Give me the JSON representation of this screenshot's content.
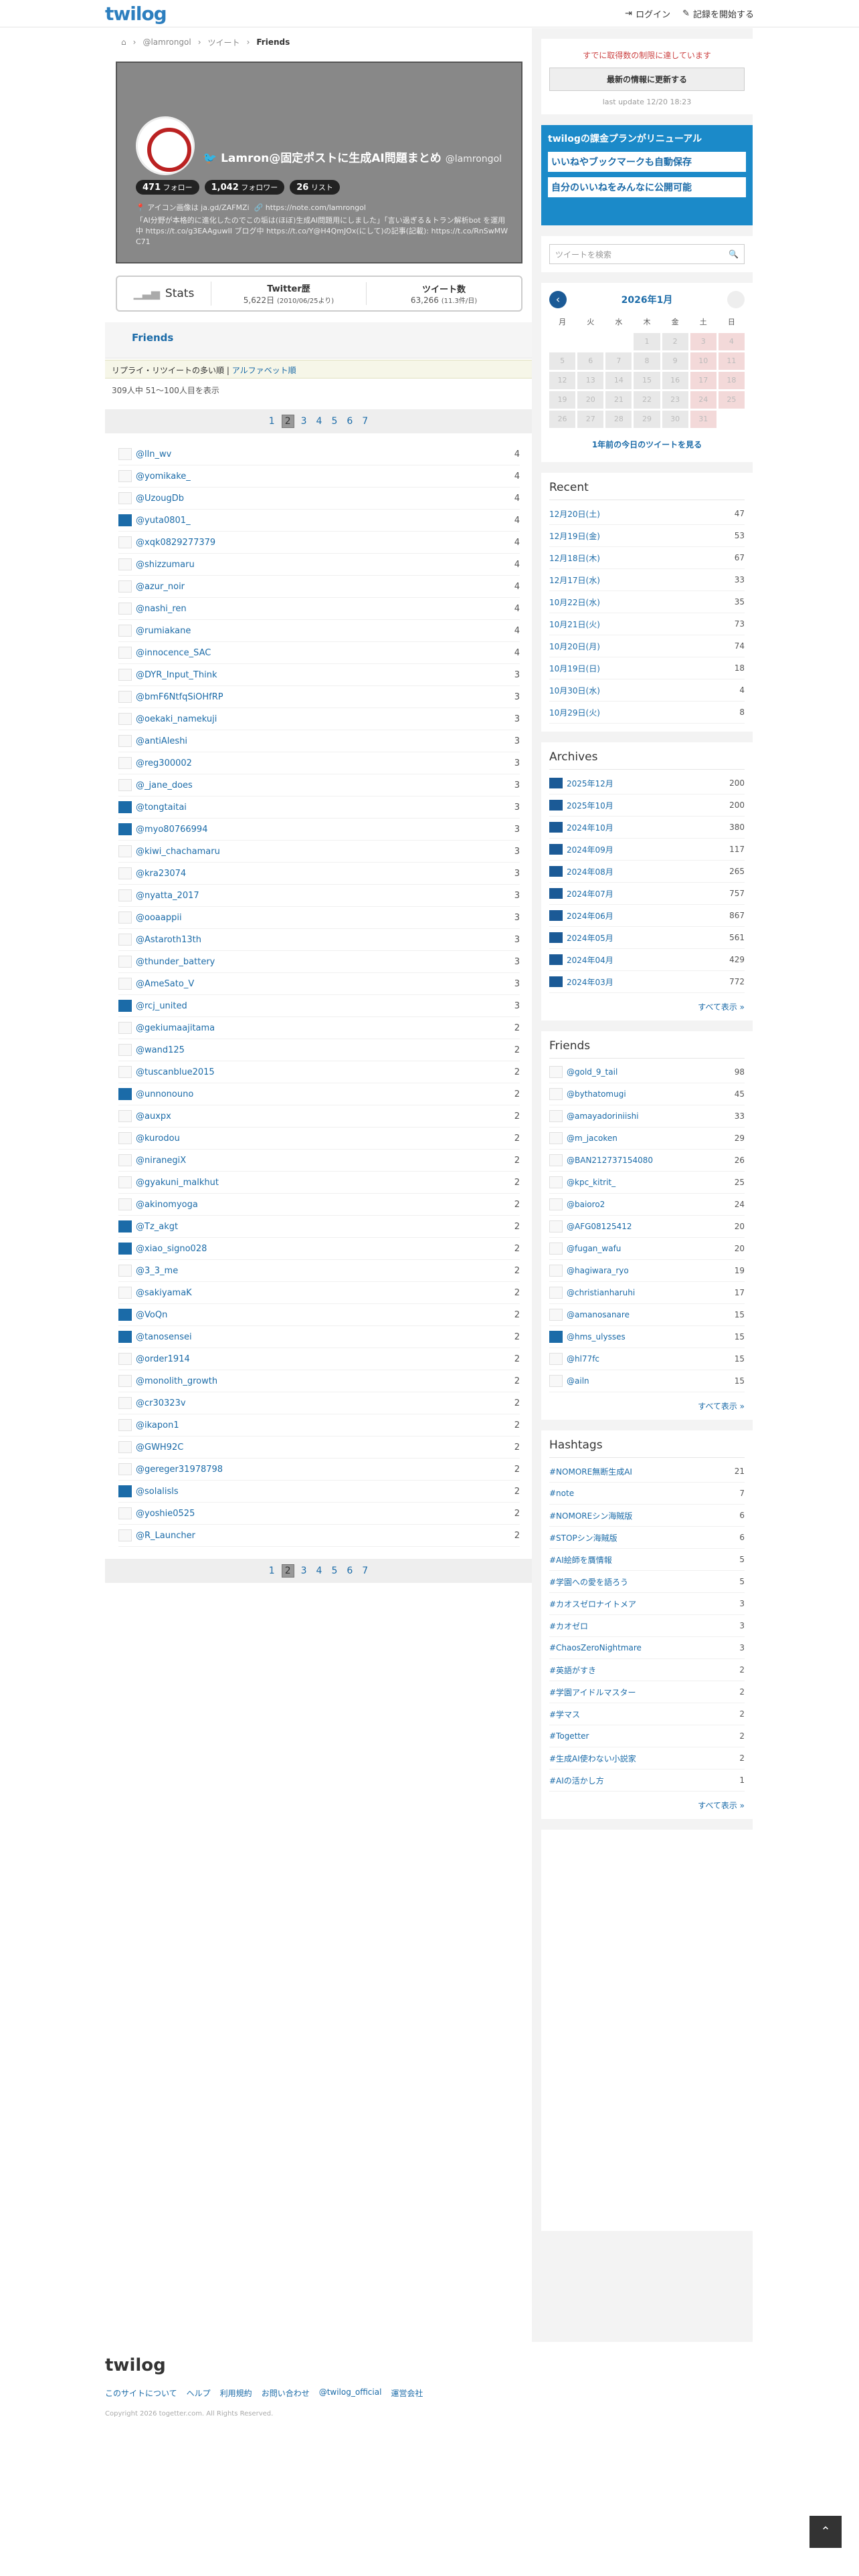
{
  "brand": "twilog",
  "nav": {
    "login": "ログイン",
    "start": "記録を開始する"
  },
  "crumb": [
    "@lamrongol",
    "ツイート",
    "Friends"
  ],
  "profile": {
    "name": "Lamron@固定ポストに生成AI問題まとめ",
    "handle": "@lamrongol",
    "followers": "471",
    "followers_label": "フォロー",
    "following": "1,042",
    "following_label": "フォロワー",
    "lists": "26",
    "lists_label": "リスト",
    "loc": "アイコン画像は ja.gd/ZAFMZi",
    "url": "https://note.com/lamrongol",
    "bio": "「AI分野が本格的に進化したのでこの垢は(ほぼ)生成AI問題用にしました」「言い過ぎる＆トラン解析bot を運用中 https://t.co/g3EAAguwII ブログ中 https://t.co/Y@H4QmJOx(にして)の記事(記載): https://t.co/RnSwMW C71"
  },
  "stats": {
    "label": "Stats",
    "hist_label": "Twitter歴",
    "hist": "5,622日",
    "hist_sub": "(2010/06/25より)",
    "tweets_label": "ツイート数",
    "tweets": "63,266",
    "tweets_sub": "(11.3件/日)"
  },
  "section": "Friends",
  "sort": {
    "a": "リプライ・リツイートの多い順",
    "b": "アルファベット順"
  },
  "count": "309人中 51〜100人目を表示",
  "pages": [
    "1",
    "2",
    "3",
    "4",
    "5",
    "6",
    "7"
  ],
  "friends": [
    {
      "n": "@lln_wv",
      "c": "4",
      "u": false
    },
    {
      "n": "@yomikake_",
      "c": "4",
      "u": false
    },
    {
      "n": "@UzougDb",
      "c": "4",
      "u": false
    },
    {
      "n": "@yuta0801_",
      "c": "4",
      "u": true
    },
    {
      "n": "@xqk0829277379",
      "c": "4",
      "u": false
    },
    {
      "n": "@shizzumaru",
      "c": "4",
      "u": false
    },
    {
      "n": "@azur_noir",
      "c": "4",
      "u": false
    },
    {
      "n": "@nashi_ren",
      "c": "4",
      "u": false
    },
    {
      "n": "@rumiakane",
      "c": "4",
      "u": false
    },
    {
      "n": "@innocence_SAC",
      "c": "4",
      "u": false
    },
    {
      "n": "@DYR_Input_Think",
      "c": "3",
      "u": false
    },
    {
      "n": "@bmF6NtfqSiOHfRP",
      "c": "3",
      "u": false
    },
    {
      "n": "@oekaki_namekuji",
      "c": "3",
      "u": false
    },
    {
      "n": "@antiAleshi",
      "c": "3",
      "u": false
    },
    {
      "n": "@reg300002",
      "c": "3",
      "u": false
    },
    {
      "n": "@_jane_does",
      "c": "3",
      "u": false
    },
    {
      "n": "@tongtaitai",
      "c": "3",
      "u": true
    },
    {
      "n": "@myo80766994",
      "c": "3",
      "u": true
    },
    {
      "n": "@kiwi_chachamaru",
      "c": "3",
      "u": false
    },
    {
      "n": "@kra23074",
      "c": "3",
      "u": false
    },
    {
      "n": "@nyatta_2017",
      "c": "3",
      "u": false
    },
    {
      "n": "@ooaappii",
      "c": "3",
      "u": false
    },
    {
      "n": "@Astaroth13th",
      "c": "3",
      "u": false
    },
    {
      "n": "@thunder_battery",
      "c": "3",
      "u": false
    },
    {
      "n": "@AmeSato_V",
      "c": "3",
      "u": false
    },
    {
      "n": "@rcj_united",
      "c": "3",
      "u": true
    },
    {
      "n": "@gekiumaajitama",
      "c": "2",
      "u": false
    },
    {
      "n": "@wand125",
      "c": "2",
      "u": false
    },
    {
      "n": "@tuscanblue2015",
      "c": "2",
      "u": false
    },
    {
      "n": "@unnonouno",
      "c": "2",
      "u": true
    },
    {
      "n": "@auxpx",
      "c": "2",
      "u": false
    },
    {
      "n": "@kurodou",
      "c": "2",
      "u": false
    },
    {
      "n": "@niranegiX",
      "c": "2",
      "u": false
    },
    {
      "n": "@gyakuni_malkhut",
      "c": "2",
      "u": false
    },
    {
      "n": "@akinomyoga",
      "c": "2",
      "u": false
    },
    {
      "n": "@Tz_akgt",
      "c": "2",
      "u": true
    },
    {
      "n": "@xiao_signo028",
      "c": "2",
      "u": true
    },
    {
      "n": "@3_3_me",
      "c": "2",
      "u": false
    },
    {
      "n": "@sakiyamaK",
      "c": "2",
      "u": false
    },
    {
      "n": "@VoQn",
      "c": "2",
      "u": true
    },
    {
      "n": "@tanosensei",
      "c": "2",
      "u": true
    },
    {
      "n": "@order1914",
      "c": "2",
      "u": false
    },
    {
      "n": "@monolith_growth",
      "c": "2",
      "u": false
    },
    {
      "n": "@cr30323v",
      "c": "2",
      "u": false
    },
    {
      "n": "@ikapon1",
      "c": "2",
      "u": false
    },
    {
      "n": "@GWH92C",
      "c": "2",
      "u": false
    },
    {
      "n": "@gereger31978798",
      "c": "2",
      "u": false
    },
    {
      "n": "@solalisls",
      "c": "2",
      "u": true
    },
    {
      "n": "@yoshie0525",
      "c": "2",
      "u": false
    },
    {
      "n": "@R_Launcher",
      "c": "2",
      "u": false
    }
  ],
  "side": {
    "limit": "すでに取得数の制限に達しています",
    "update_btn": "最新の情報に更新する",
    "last": "last update 12/20 18:23",
    "ad1": "twilogの課金プランがリニューアル",
    "ad2": "いいねやブックマークも自動保存",
    "ad3": "自分のいいねをみんなに公開可能",
    "search_ph": "ツイートを検索",
    "cal_title": "2026年1月",
    "cal_wd": [
      "月",
      "火",
      "水",
      "木",
      "金",
      "土",
      "日"
    ],
    "cal_link": "1年前の今日のツイートを見る",
    "recent_title": "Recent",
    "recent": [
      {
        "d": "12月20日(土)",
        "n": "47"
      },
      {
        "d": "12月19日(金)",
        "n": "53"
      },
      {
        "d": "12月18日(木)",
        "n": "67"
      },
      {
        "d": "12月17日(水)",
        "n": "33"
      },
      {
        "d": "10月22日(水)",
        "n": "35"
      },
      {
        "d": "10月21日(火)",
        "n": "73"
      },
      {
        "d": "10月20日(月)",
        "n": "74"
      },
      {
        "d": "10月19日(日)",
        "n": "18"
      },
      {
        "d": "10月30日(水)",
        "n": "4"
      },
      {
        "d": "10月29日(火)",
        "n": "8"
      }
    ],
    "archives_title": "Archives",
    "archives": [
      {
        "d": "2025年12月",
        "n": "200"
      },
      {
        "d": "2025年10月",
        "n": "200"
      },
      {
        "d": "2024年10月",
        "n": "380"
      },
      {
        "d": "2024年09月",
        "n": "117"
      },
      {
        "d": "2024年08月",
        "n": "265"
      },
      {
        "d": "2024年07月",
        "n": "757"
      },
      {
        "d": "2024年06月",
        "n": "867"
      },
      {
        "d": "2024年05月",
        "n": "561"
      },
      {
        "d": "2024年04月",
        "n": "429"
      },
      {
        "d": "2024年03月",
        "n": "772"
      }
    ],
    "friends_title": "Friends",
    "friends": [
      {
        "d": "@gold_9_tail",
        "n": "98",
        "u": false
      },
      {
        "d": "@bythatomugi",
        "n": "45",
        "u": false
      },
      {
        "d": "@amayadoriniishi",
        "n": "33",
        "u": false
      },
      {
        "d": "@m_jacoken",
        "n": "29",
        "u": false
      },
      {
        "d": "@BAN212737154080",
        "n": "26",
        "u": false
      },
      {
        "d": "@kpc_kitrit_",
        "n": "25",
        "u": false
      },
      {
        "d": "@baioro2",
        "n": "24",
        "u": false
      },
      {
        "d": "@AFG08125412",
        "n": "20",
        "u": false
      },
      {
        "d": "@fugan_wafu",
        "n": "20",
        "u": false
      },
      {
        "d": "@hagiwara_ryo",
        "n": "19",
        "u": false
      },
      {
        "d": "@christianharuhi",
        "n": "17",
        "u": false
      },
      {
        "d": "@amanosanare",
        "n": "15",
        "u": false
      },
      {
        "d": "@hms_ulysses",
        "n": "15",
        "u": true
      },
      {
        "d": "@hl77fc",
        "n": "15",
        "u": false
      },
      {
        "d": "@ailn",
        "n": "15",
        "u": false
      }
    ],
    "hash_title": "Hashtags",
    "hash": [
      {
        "d": "#NOMORE無断生成AI",
        "n": "21"
      },
      {
        "d": "#note",
        "n": "7"
      },
      {
        "d": "#NOMOREシン海賊版",
        "n": "6"
      },
      {
        "d": "#STOPシン海賊版",
        "n": "6"
      },
      {
        "d": "#AI絵師を贋情報",
        "n": "5"
      },
      {
        "d": "#学園への愛を語ろう",
        "n": "5"
      },
      {
        "d": "#カオスゼロナイトメア",
        "n": "3"
      },
      {
        "d": "#カオゼロ",
        "n": "3"
      },
      {
        "d": "#ChaosZeroNightmare",
        "n": "3"
      },
      {
        "d": "#英語がすき",
        "n": "2"
      },
      {
        "d": "#学園アイドルマスター",
        "n": "2"
      },
      {
        "d": "#学マス",
        "n": "2"
      },
      {
        "d": "#Togetter",
        "n": "2"
      },
      {
        "d": "#生成AI使わない小説家",
        "n": "2"
      },
      {
        "d": "#AIの活かし方",
        "n": "1"
      }
    ],
    "more": "すべて表示 »"
  },
  "footer": {
    "links": [
      "このサイトについて",
      "ヘルプ",
      "利用規約",
      "お問い合わせ",
      "@twilog_official",
      "運営会社"
    ],
    "copy": "Copyright 2026 togetter.com. All Rights Reserved."
  }
}
